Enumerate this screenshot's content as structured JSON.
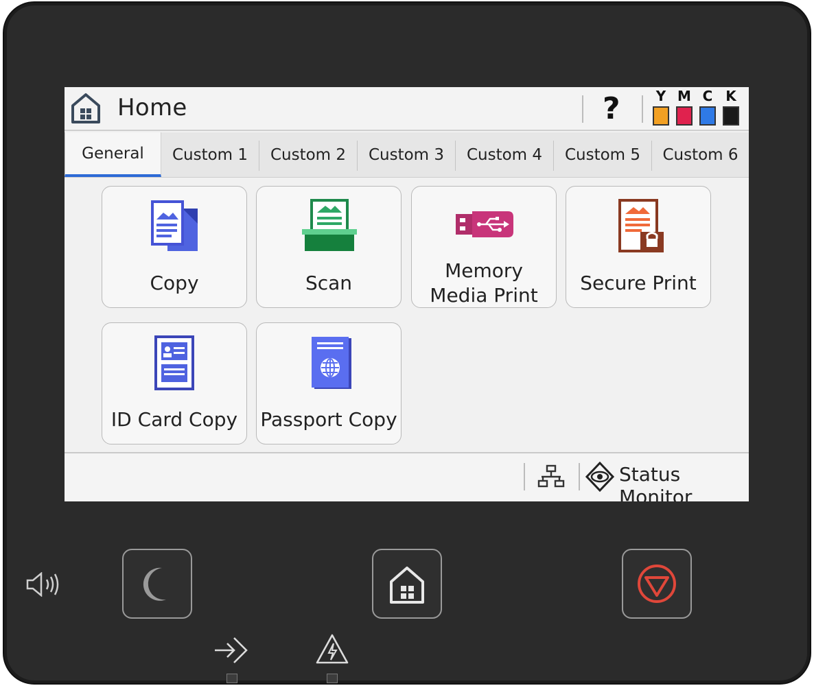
{
  "header": {
    "title": "Home",
    "help_label": "?",
    "inks": [
      {
        "label": "Y",
        "color": "#f2a023"
      },
      {
        "label": "M",
        "color": "#e0224e"
      },
      {
        "label": "C",
        "color": "#2f7ae6"
      },
      {
        "label": "K",
        "color": "#1a1a1a"
      }
    ]
  },
  "tabs": [
    {
      "label": "General",
      "active": true
    },
    {
      "label": "Custom 1"
    },
    {
      "label": "Custom 2"
    },
    {
      "label": "Custom 3"
    },
    {
      "label": "Custom 4"
    },
    {
      "label": "Custom 5"
    },
    {
      "label": "Custom 6"
    }
  ],
  "tiles": {
    "copy": {
      "label": "Copy",
      "icon": "copy-icon"
    },
    "scan": {
      "label": "Scan",
      "icon": "scan-icon"
    },
    "memory": {
      "line1": "Memory",
      "line2": "Media Print",
      "icon": "usb-icon"
    },
    "secure": {
      "label": "Secure Print",
      "icon": "lock-document-icon"
    },
    "idcard": {
      "label": "ID Card Copy",
      "icon": "id-card-icon"
    },
    "passport": {
      "label": "Passport Copy",
      "icon": "passport-icon"
    }
  },
  "footer": {
    "status_label": "Status Monitor",
    "network_icon": "network-icon",
    "status_icon": "eye-icon"
  },
  "hardware": {
    "sleep_icon": "moon-icon",
    "home_icon": "home-icon",
    "stop_icon": "stop-icon",
    "sound_icon": "speaker-icon",
    "data_icon": "data-in-icon",
    "error_icon": "warning-icon",
    "accent": "#e0473a"
  }
}
